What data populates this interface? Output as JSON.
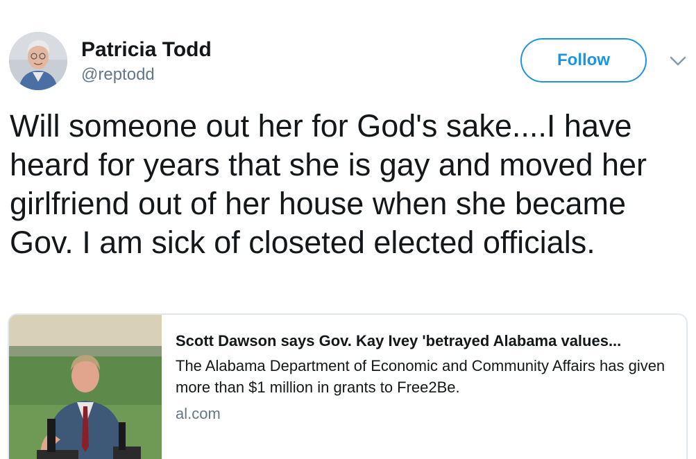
{
  "tweet": {
    "author": {
      "name": "Patricia Todd",
      "handle": "@reptodd"
    },
    "follow_label": "Follow",
    "text": "Will someone out her for God's sake....I have heard for years that she is gay and moved her girlfriend out of her house when she became Gov.  I am sick of closeted elected officials.",
    "card": {
      "title": "Scott Dawson says Gov. Kay Ivey 'betrayed Alabama values...",
      "description": "The Alabama Department of Economic and Community Affairs has given more than $1 million in grants to Free2Be.",
      "domain": "al.com"
    }
  },
  "icons": {
    "more": "chevron-down-icon"
  },
  "colors": {
    "accent": "#1b95e0",
    "text": "#14171a",
    "secondary_text": "#657786",
    "card_border": "#e1e8ed"
  }
}
